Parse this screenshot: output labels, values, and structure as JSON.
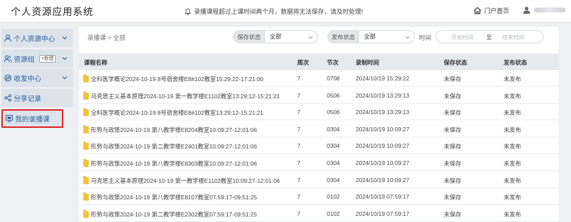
{
  "app": {
    "title": "个人资源应用系统",
    "notice": "录播课程超过上课时间两个月，数据将无法保存，请及时处理!",
    "portal_label": "门户首页"
  },
  "sidebar": {
    "items": [
      {
        "label": "个人资源中心",
        "icon": "person-icon",
        "has_chevron": true
      },
      {
        "label": "资源组",
        "icon": "group-icon",
        "badge": "+新建",
        "has_chevron": true
      },
      {
        "label": "收发中心",
        "icon": "transfer-icon",
        "has_chevron": true
      },
      {
        "label": "分享记录",
        "icon": "share-icon",
        "has_chevron": false
      },
      {
        "label": "我的录播课",
        "icon": "monitor-icon",
        "has_chevron": false,
        "active": true
      }
    ]
  },
  "breadcrumb": {
    "root": "录播课",
    "sep": ">",
    "current": "全部"
  },
  "filters": {
    "save_status": {
      "label": "保存状态",
      "value": "全部"
    },
    "publish_status": {
      "label": "发布状态",
      "value": "全部"
    },
    "time": {
      "label": "时间",
      "start_placeholder": "开始时间",
      "to": "至",
      "end_placeholder": "结束时间"
    }
  },
  "table": {
    "headers": [
      "课程名称",
      "周次",
      "节次",
      "录制时间",
      "保存状态",
      "发布状态"
    ],
    "rows": [
      {
        "name": "全科医学概论2024-10-19 8号宿舍楼E8#102教室15:29:22-17:21:00",
        "week": "7",
        "period": "0708",
        "time": "2024/10/19 15:29:22",
        "save": "未保存",
        "publish": "未发布"
      },
      {
        "name": "马克思主义基本原理2024-10-19 第一教学楼E1102教室13:29:12-15:21:21",
        "week": "7",
        "period": "0506",
        "time": "2024/10/19 13:29:13",
        "save": "未保存",
        "publish": "未发布"
      },
      {
        "name": "全科医学概论2024-10-19 8号宿舍楼E8#102教室13:29:12-15:21:21",
        "week": "7",
        "period": "0506",
        "time": "2024/10/19 13:29:13",
        "save": "未保存",
        "publish": "未发布"
      },
      {
        "name": "形势与政策2024-10-19 第八教学楼E8204教室10:09:27-12:01:06",
        "week": "7",
        "period": "0304",
        "time": "2024/10/19 10:09:27",
        "save": "未保存",
        "publish": "未发布"
      },
      {
        "name": "形势与政策2024-10-19 第二教学楼E2401教室10:09:27-12:01:06",
        "week": "7",
        "period": "0304",
        "time": "2024/10/19 10:09:27",
        "save": "未保存",
        "publish": "未发布"
      },
      {
        "name": "形势与政策2024-10-19 第八教学楼E8303教室10:09:27-12:01:06",
        "week": "7",
        "period": "0304",
        "time": "2024/10/19 10:09:27",
        "save": "未保存",
        "publish": "未发布"
      },
      {
        "name": "马克思主义基本原理2024-10-19 第一教学楼E1102教室10:09:27-12:01:06",
        "week": "7",
        "period": "0304",
        "time": "2024/10/19 10:09:27",
        "save": "未保存",
        "publish": "未发布"
      },
      {
        "name": "形势与政策2024-10-19 第八教学楼E8107教室07:59:17-09:51:25",
        "week": "7",
        "period": "0102",
        "time": "2024/10/19 07:59:17",
        "save": "未保存",
        "publish": "未发布"
      },
      {
        "name": "形势与政策2024-10-19 第二教学楼E2302教室07:59:17-09:51:25",
        "week": "7",
        "period": "0102",
        "time": "2024/10/19 07:59:17",
        "save": "未保存",
        "publish": "未发布"
      }
    ]
  },
  "colors": {
    "accent": "#2a5d9f",
    "highlight_border": "#e02020",
    "folder": "#f2c23a"
  }
}
